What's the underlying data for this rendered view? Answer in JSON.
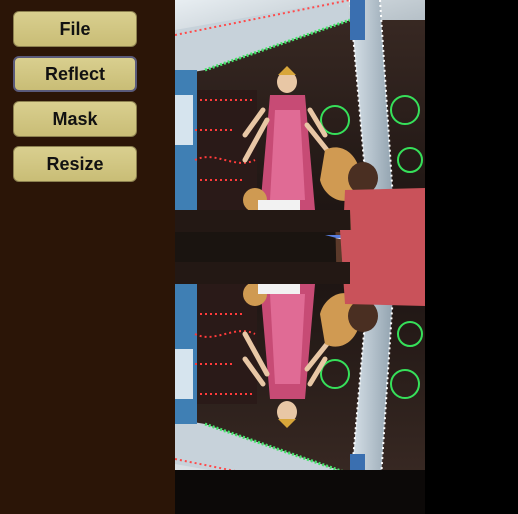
{
  "menu": {
    "items": [
      {
        "label": "File"
      },
      {
        "label": "Reflect"
      },
      {
        "label": "Mask"
      },
      {
        "label": "Resize"
      }
    ],
    "selected": "Reflect"
  },
  "image_panel": {
    "content": "photo",
    "mode": "reflected"
  },
  "colors": {
    "sidebar_bg": "#2b1507",
    "button_bg": "#d5c985",
    "button_text": "#111111",
    "selected_border": "#5a5a7a"
  }
}
